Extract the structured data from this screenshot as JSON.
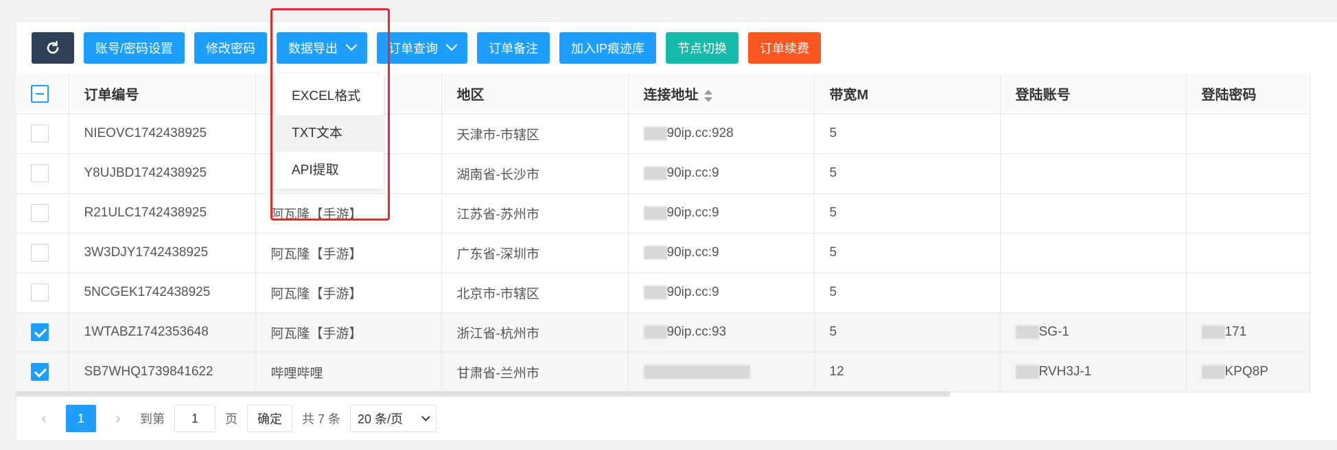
{
  "toolbar": {
    "refresh_icon": "refresh-icon",
    "buttons": [
      {
        "label": "账号/密码设置",
        "color": "#1e9fff"
      },
      {
        "label": "修改密码",
        "color": "#1e9fff"
      },
      {
        "label": "数据导出",
        "color": "#1e9fff",
        "dropdown": true
      },
      {
        "label": "订单查询",
        "color": "#1e9fff",
        "dropdown": true
      },
      {
        "label": "订单备注",
        "color": "#1e9fff"
      },
      {
        "label": "加入IP痕迹库",
        "color": "#1e9fff"
      },
      {
        "label": "节点切换",
        "color": "#16baaa"
      },
      {
        "label": "订单续费",
        "color": "#ff5722"
      }
    ]
  },
  "export_menu": {
    "items": [
      "EXCEL格式",
      "TXT文本",
      "API提取"
    ]
  },
  "table": {
    "headers": [
      "订单编号",
      "",
      "地区",
      "连接地址",
      "带宽M",
      "登陆账号",
      "登陆密码"
    ],
    "rows": [
      {
        "checked": false,
        "order": "NIEOVC1742438925",
        "game": "",
        "region": "天津市-市辖区",
        "addr": "90ip.cc:92",
        "addr_tail": "8",
        "bw": "5",
        "account": "",
        "password": ""
      },
      {
        "checked": false,
        "order": "Y8UJBD1742438925",
        "game": "",
        "region": "湖南省-长沙市",
        "addr": "90ip.cc:9",
        "addr_tail": "",
        "bw": "5",
        "account": "",
        "password": ""
      },
      {
        "checked": false,
        "order": "R21ULC1742438925",
        "game": "阿瓦隆【手游】",
        "region": "江苏省-苏州市",
        "addr": "90ip.cc:9",
        "addr_tail": "",
        "bw": "5",
        "account": "",
        "password": ""
      },
      {
        "checked": false,
        "order": "3W3DJY1742438925",
        "game": "阿瓦隆【手游】",
        "region": "广东省-深圳市",
        "addr": "90ip.cc:9",
        "addr_tail": "",
        "bw": "5",
        "account": "",
        "password": ""
      },
      {
        "checked": false,
        "order": "5NCGEK1742438925",
        "game": "阿瓦隆【手游】",
        "region": "北京市-市辖区",
        "addr": "90ip.cc:9",
        "addr_tail": "",
        "bw": "5",
        "account": "",
        "password": ""
      },
      {
        "checked": true,
        "order": "1WTABZ1742353648",
        "game": "阿瓦隆【手游】",
        "region": "浙江省-杭州市",
        "addr": "90ip.cc:9",
        "addr_tail": "3",
        "bw": "5",
        "account": "SG-1",
        "password": "171"
      },
      {
        "checked": true,
        "order": "SB7WHQ1739841622",
        "game": "哔哩哔哩",
        "region": "甘肃省-兰州市",
        "addr": "",
        "addr_tail": "",
        "bw": "12",
        "account": "RVH3J-1",
        "password": "KPQ8P"
      }
    ]
  },
  "pager": {
    "current": "1",
    "goto_label": "到第",
    "page_input": "1",
    "page_suffix": "页",
    "confirm": "确定",
    "total": "共 7 条",
    "per_page": "20 条/页"
  }
}
